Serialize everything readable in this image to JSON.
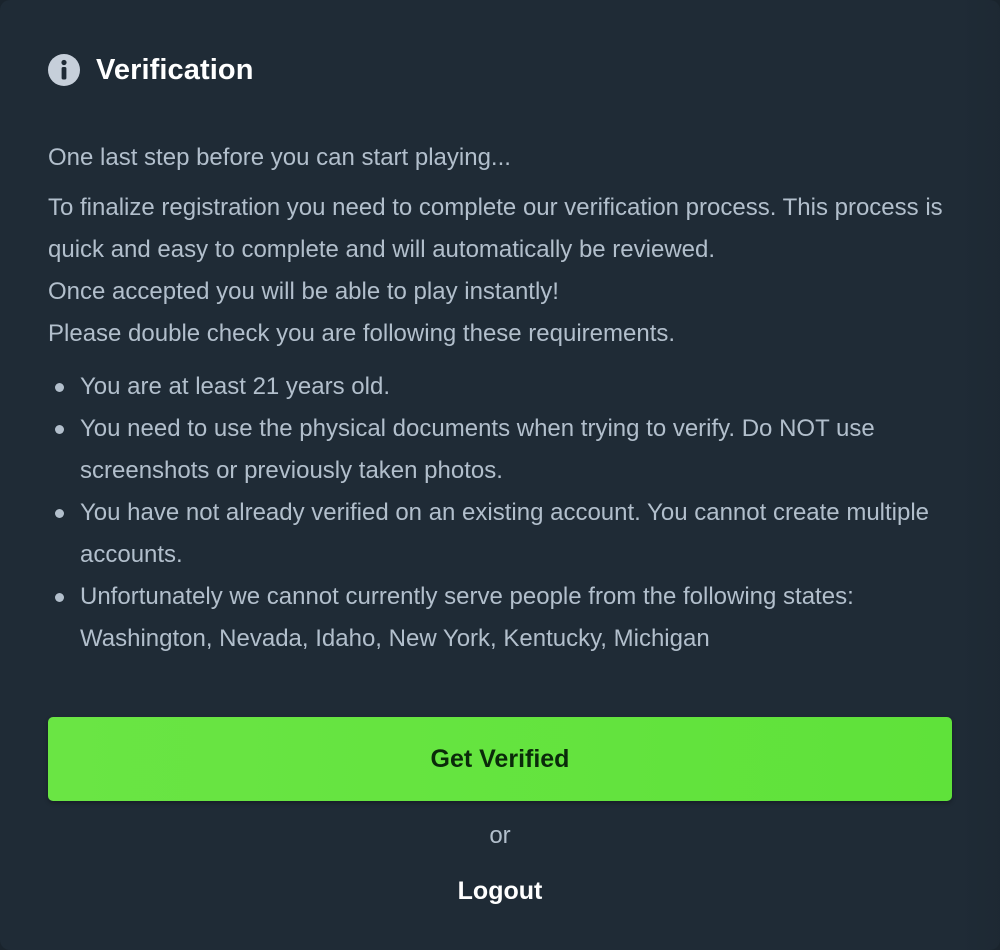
{
  "dialog": {
    "title": "Verification",
    "icon": "info-icon",
    "intro_lead": "One last step before you can start playing...",
    "paragraphs": [
      "To finalize registration you need to complete our verification process. This process is quick and easy to complete and will automatically be reviewed.",
      "Once accepted you will be able to play instantly!",
      "Please double check you are following these requirements."
    ],
    "requirements": [
      "You are at least 21 years old.",
      "You need to use the physical documents when trying to verify. Do NOT use screenshots or previously taken photos.",
      "You have not already verified on an existing account. You cannot create multiple accounts.",
      "Unfortunately we cannot currently serve people from the following states: Washington, Nevada, Idaho, New York, Kentucky, Michigan"
    ],
    "verify_button": "Get Verified",
    "separator": "or",
    "logout_label": "Logout"
  },
  "colors": {
    "background": "#1f2b36",
    "text": "#b2bfcc",
    "title": "#ffffff",
    "accent": "#62e33e",
    "button_text": "#0a2a0a"
  }
}
